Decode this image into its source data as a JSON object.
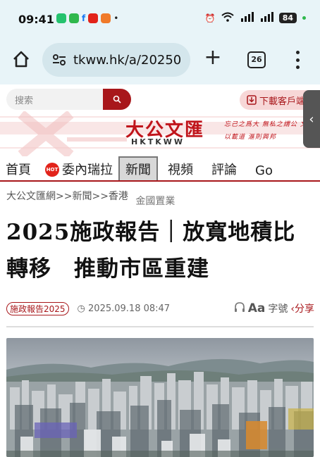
{
  "status_bar": {
    "time": "09:41",
    "battery": "84"
  },
  "browser": {
    "url": "tkww.hk/a/20250",
    "tab_count": "26"
  },
  "site": {
    "search_placeholder": "搜索",
    "download_label": "下載客戶端",
    "logo": "大公文匯",
    "logo_sub": "HKTKWW",
    "motto": "忘己之爲大 無私之謂公 文以載道 滙則興邦"
  },
  "nav": {
    "items": [
      "首頁",
      "委內瑞拉",
      "新聞",
      "視頻",
      "評論",
      "Go"
    ],
    "active": "新聞",
    "hot_label": "HOT"
  },
  "article": {
    "breadcrumb": "大公文匯網>>新聞>>香港",
    "section_tag": "金國置業",
    "headline_line1": "2025施政報告｜放寬地積比",
    "headline_line2": "轉移　推動市區重建",
    "tag": "施政報告2025",
    "date": "2025.09.18 08:47",
    "font_label": "字號",
    "share_label": "分享",
    "aa": "Aa"
  }
}
